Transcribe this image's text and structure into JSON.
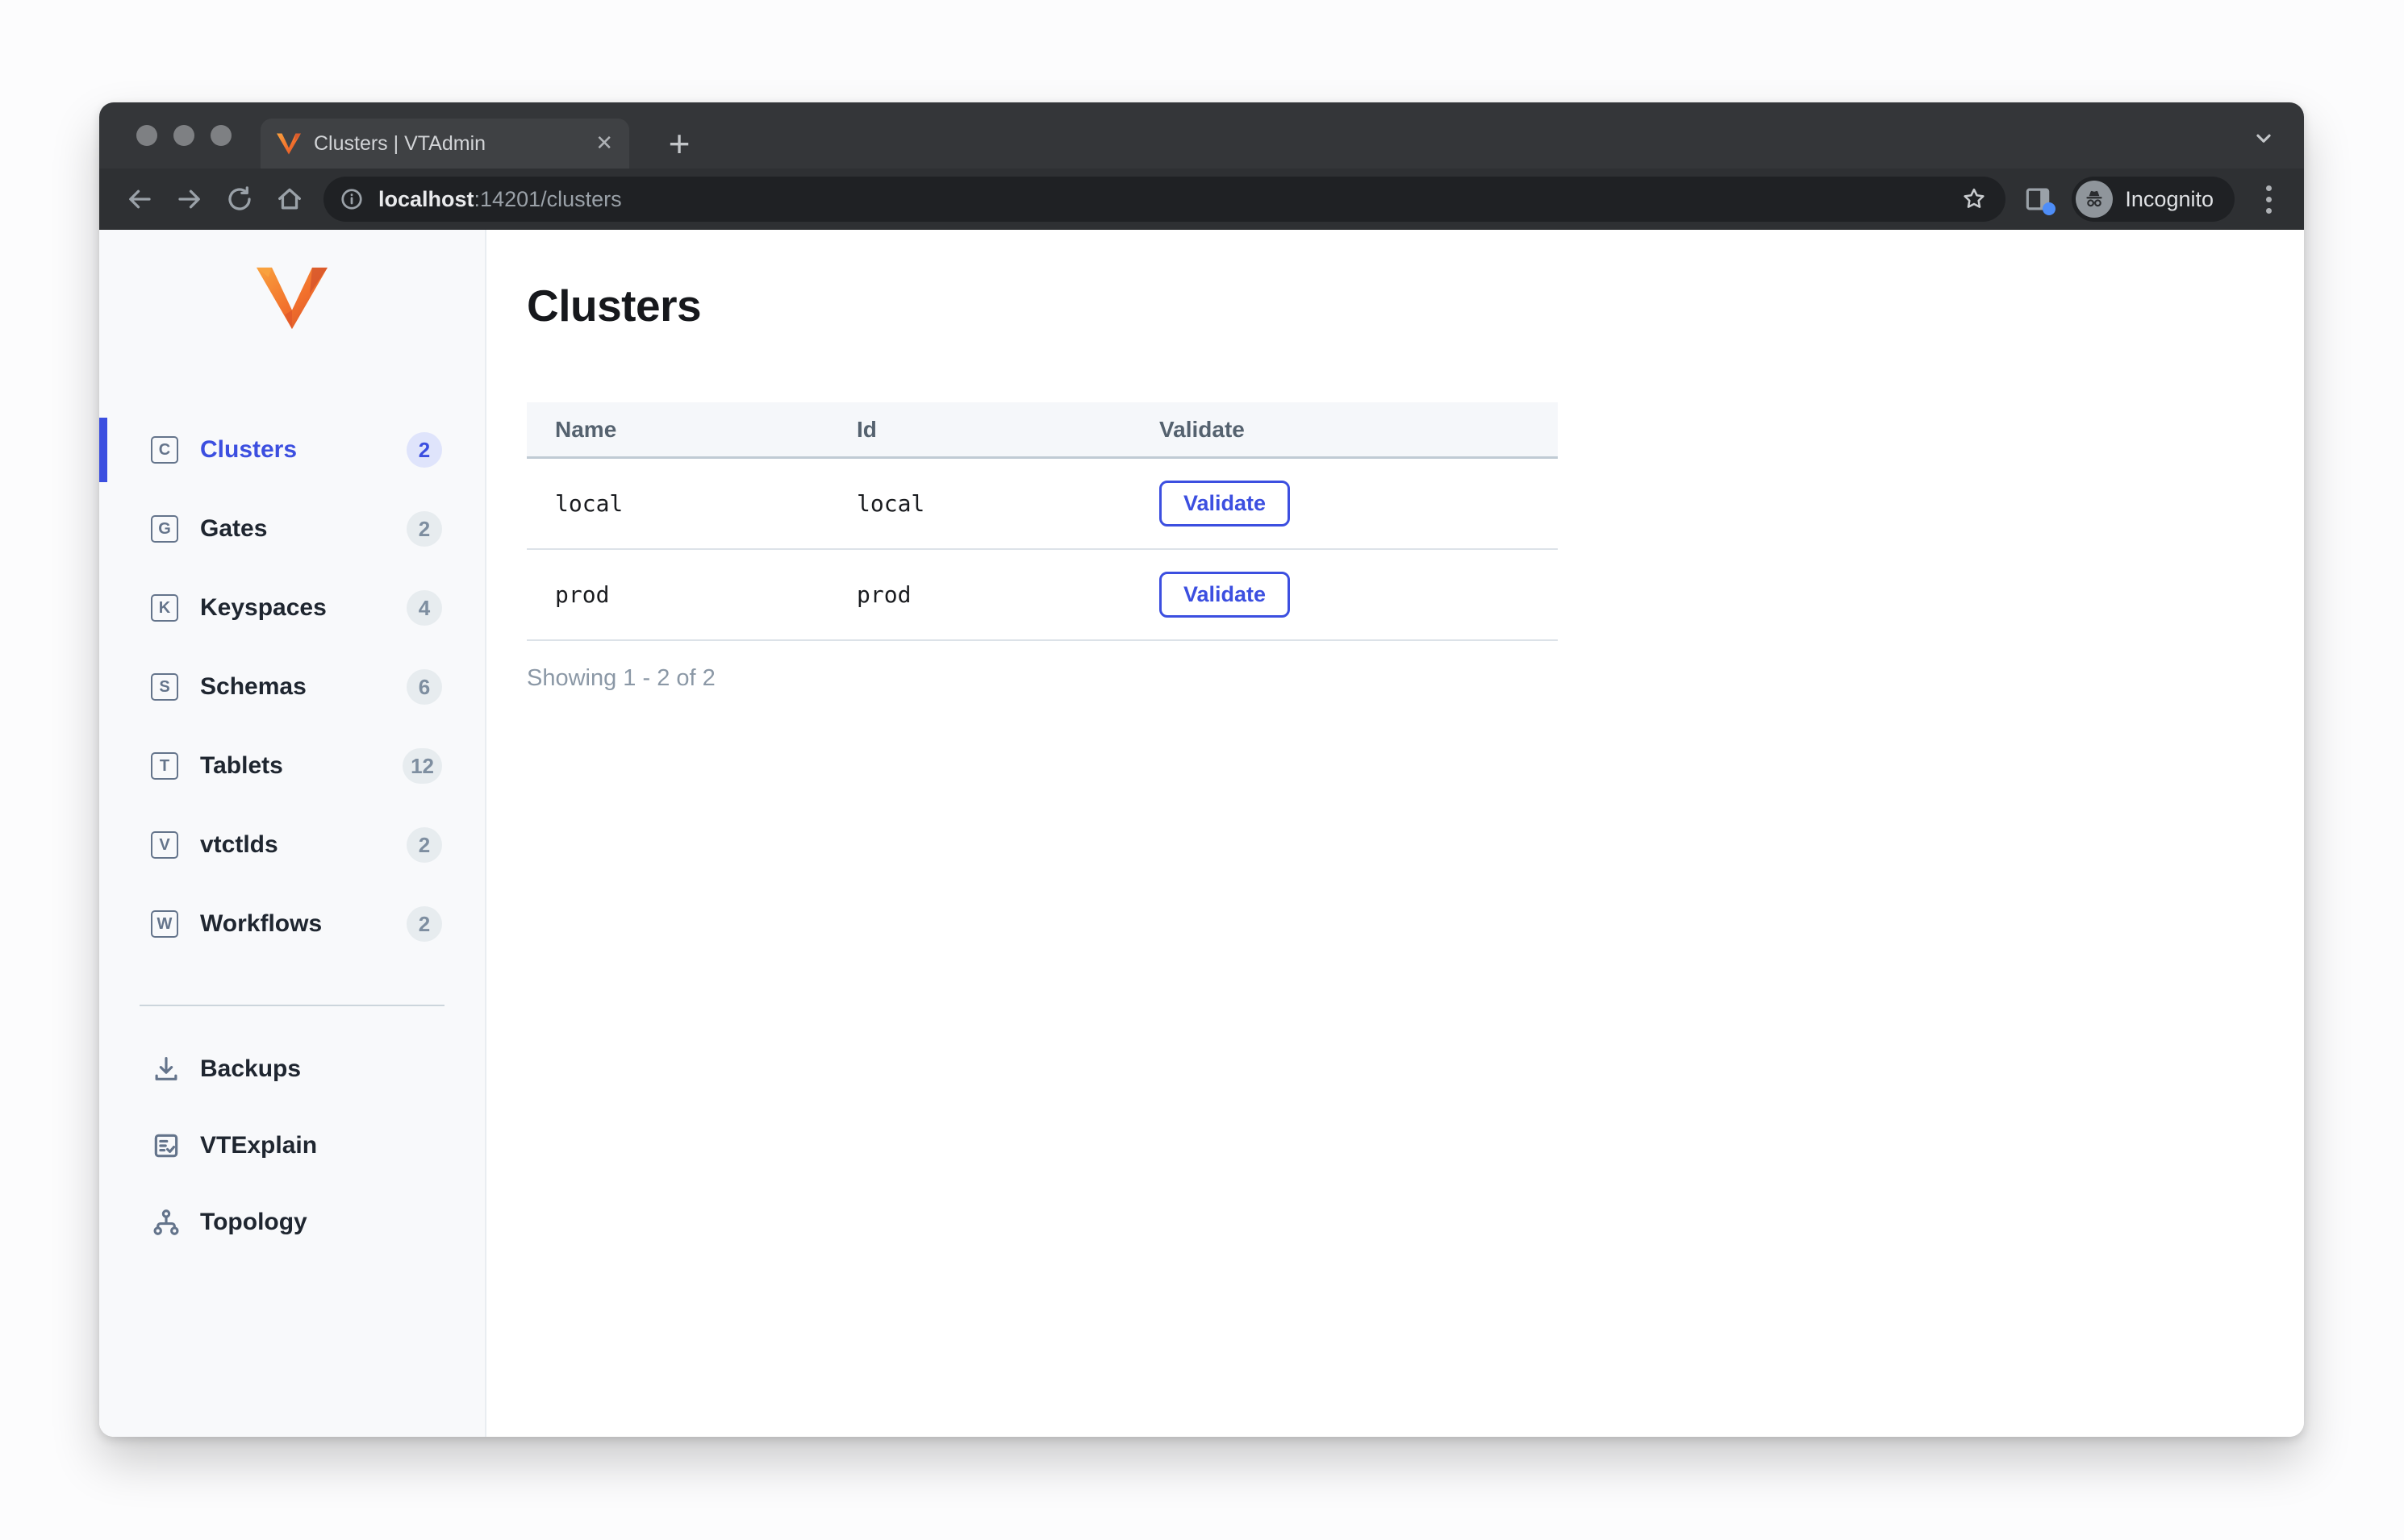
{
  "browser": {
    "tab_title": "Clusters | VTAdmin",
    "url_host": "localhost",
    "url_rest": ":14201/clusters",
    "incognito_label": "Incognito",
    "icons": {
      "close": "✕",
      "plus": "+"
    }
  },
  "sidebar": {
    "primary": [
      {
        "letter": "C",
        "label": "Clusters",
        "count": "2",
        "active": true
      },
      {
        "letter": "G",
        "label": "Gates",
        "count": "2",
        "active": false
      },
      {
        "letter": "K",
        "label": "Keyspaces",
        "count": "4",
        "active": false
      },
      {
        "letter": "S",
        "label": "Schemas",
        "count": "6",
        "active": false
      },
      {
        "letter": "T",
        "label": "Tablets",
        "count": "12",
        "active": false
      },
      {
        "letter": "V",
        "label": "vtctlds",
        "count": "2",
        "active": false
      },
      {
        "letter": "W",
        "label": "Workflows",
        "count": "2",
        "active": false
      }
    ],
    "secondary": [
      {
        "icon": "download-icon",
        "label": "Backups"
      },
      {
        "icon": "document-check-icon",
        "label": "VTExplain"
      },
      {
        "icon": "topology-icon",
        "label": "Topology"
      }
    ]
  },
  "main": {
    "title": "Clusters",
    "table": {
      "columns": [
        "Name",
        "Id",
        "Validate"
      ],
      "rows": [
        {
          "name": "local",
          "id": "local",
          "action": "Validate"
        },
        {
          "name": "prod",
          "id": "prod",
          "action": "Validate"
        }
      ]
    },
    "footer": "Showing 1 - 2 of 2"
  },
  "colors": {
    "accent": "#3c4fe0",
    "vitess_orange_light": "#f9a13e",
    "vitess_orange_dark": "#e0562a",
    "sidebar_bg": "#f8f9fb",
    "badge_active_bg": "#dfe4fb",
    "badge_bg": "#e7ecef"
  }
}
